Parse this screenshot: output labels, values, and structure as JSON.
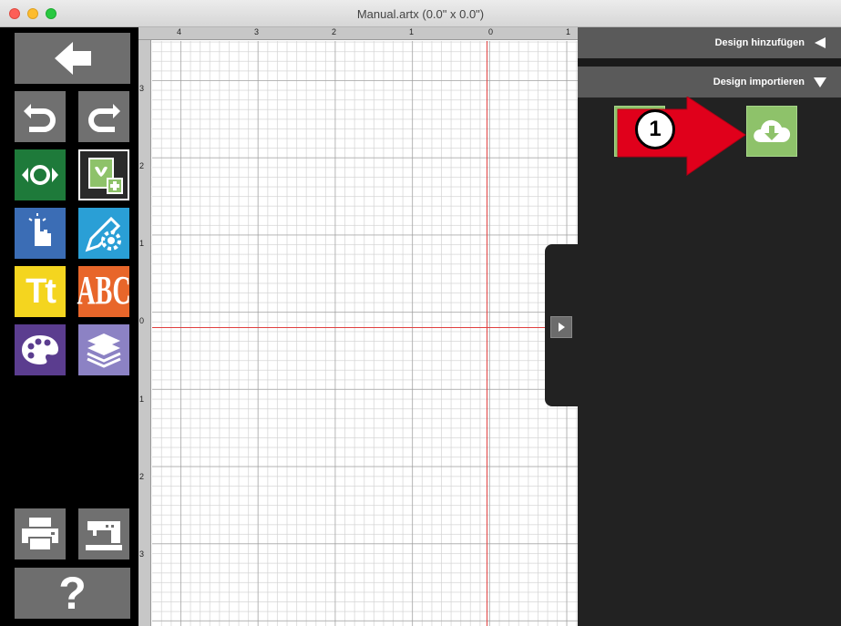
{
  "window": {
    "title": "Manual.artx (0.0\" x 0.0\")"
  },
  "toolbar": {
    "buttons": [
      {
        "name": "back-button",
        "icon": "arrow-left-icon"
      },
      {
        "name": "undo-button",
        "icon": "undo-icon"
      },
      {
        "name": "redo-button",
        "icon": "redo-icon"
      },
      {
        "name": "view-button",
        "icon": "eye-icon"
      },
      {
        "name": "add-design-button",
        "icon": "add-design-icon"
      },
      {
        "name": "select-button",
        "icon": "touch-icon"
      },
      {
        "name": "edit-settings-button",
        "icon": "pencil-gear-icon"
      },
      {
        "name": "text-button",
        "icon": "text-icon"
      },
      {
        "name": "monogram-button",
        "icon": "monogram-icon"
      },
      {
        "name": "color-palette-button",
        "icon": "palette-icon"
      },
      {
        "name": "layers-button",
        "icon": "layers-icon"
      },
      {
        "name": "print-button",
        "icon": "printer-icon"
      },
      {
        "name": "sewing-machine-button",
        "icon": "sewing-machine-icon"
      },
      {
        "name": "help-button",
        "icon": "question-icon"
      }
    ],
    "text_icon_label": "Tt",
    "monogram_icon_label": "ABC",
    "help_label": "?"
  },
  "ruler": {
    "top_labels": [
      "4",
      "3",
      "2",
      "1",
      "0",
      "1"
    ],
    "left_labels": [
      "3",
      "2",
      "1",
      "0",
      "1",
      "2",
      "3"
    ]
  },
  "panel": {
    "add_design_label": "Design hinzufügen",
    "import_design_label": "Design importieren",
    "import_tile_icon": "cloud-download-icon",
    "callout_number": "1"
  },
  "colors": {
    "toolbar_gray": "#707070",
    "green": "#1e7a3a",
    "blue": "#3b6db5",
    "cyan": "#2a9fd6",
    "yellow": "#f4d51f",
    "orange": "#e8662a",
    "purple": "#5b3d8f",
    "lavender": "#8c82c4",
    "tile_green": "#8ec26a",
    "arrow_red": "#e0001b"
  }
}
